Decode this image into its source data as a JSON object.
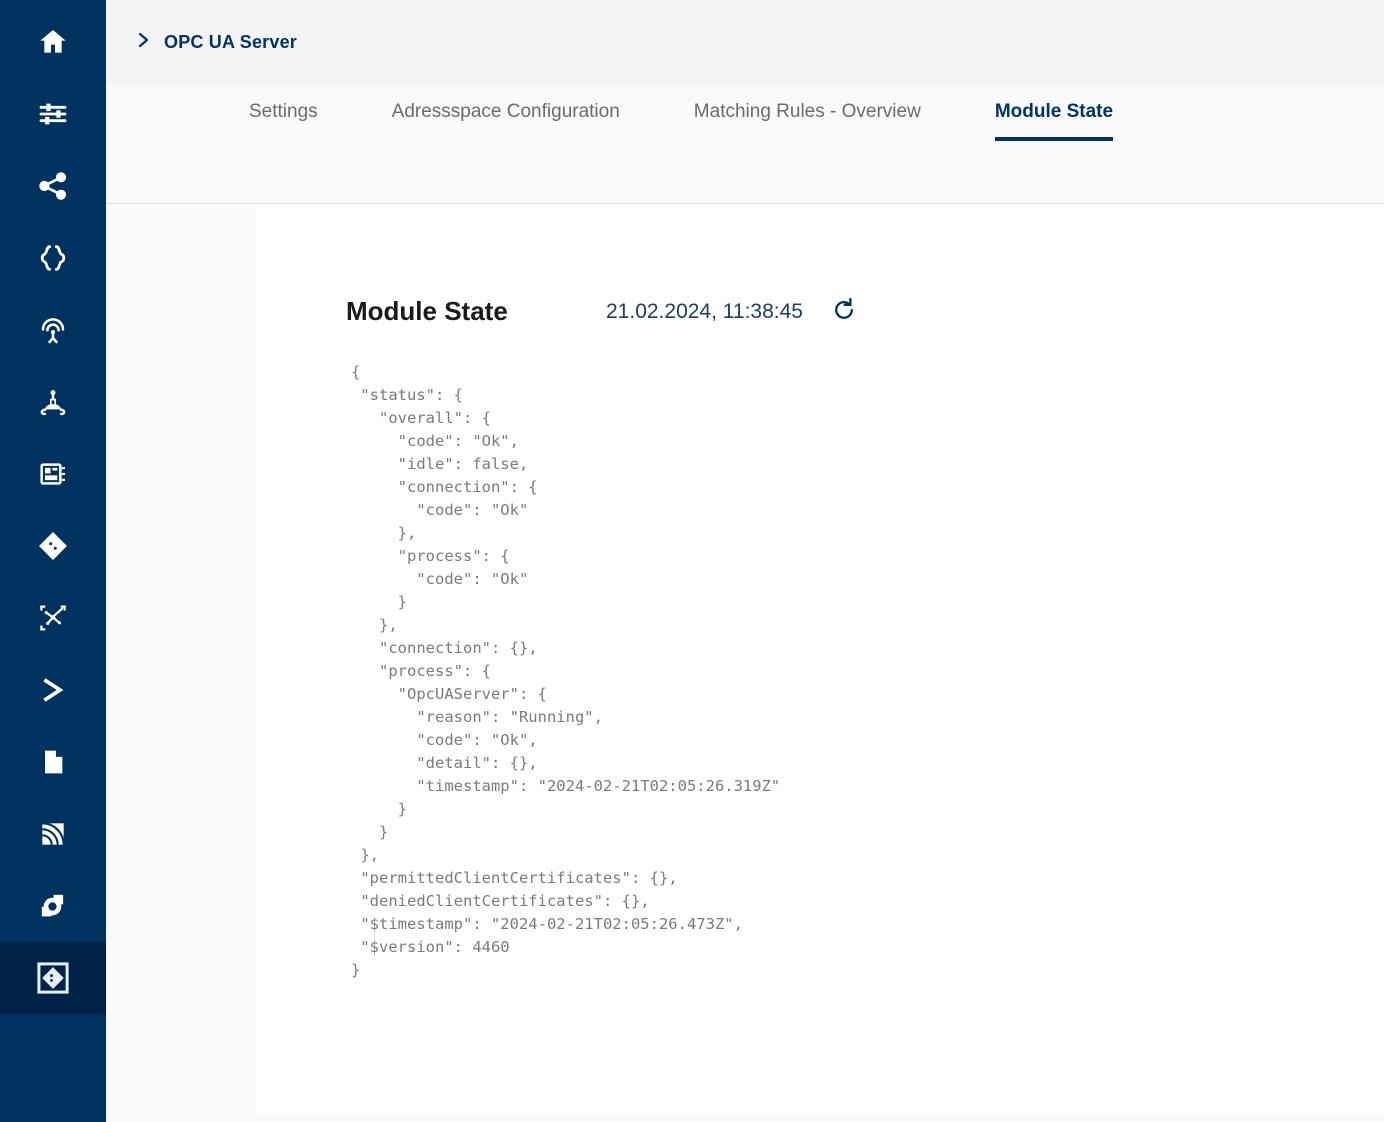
{
  "sidebar": {
    "items": [
      {
        "name": "home-icon",
        "label": "Home",
        "active": false
      },
      {
        "name": "sliders-icon",
        "label": "Settings",
        "active": false
      },
      {
        "name": "share-icon",
        "label": "Share",
        "active": false
      },
      {
        "name": "curly-braces-icon",
        "label": "JSON",
        "active": false
      },
      {
        "name": "broadcast-icon",
        "label": "Broadcast",
        "active": false
      },
      {
        "name": "robot-icon",
        "label": "Robot",
        "active": false
      },
      {
        "name": "device-icon",
        "label": "Device",
        "active": false
      },
      {
        "name": "diamond-icon",
        "label": "Diamond",
        "active": false
      },
      {
        "name": "topology-icon",
        "label": "Topology",
        "active": false
      },
      {
        "name": "chevron-right-icon",
        "label": "Console",
        "active": false
      },
      {
        "name": "file-icon",
        "label": "File",
        "active": false
      },
      {
        "name": "signal-icon",
        "label": "Signal",
        "active": false
      },
      {
        "name": "gear-ring-icon",
        "label": "Service",
        "active": false
      },
      {
        "name": "boxed-diamond-icon",
        "label": "OPC UA Server",
        "active": true
      }
    ]
  },
  "header": {
    "breadcrumb_icon": "chevron-right-icon",
    "title": "OPC UA Server"
  },
  "tabs": [
    {
      "label": "Settings",
      "active": false
    },
    {
      "label": "Adressspace Configuration",
      "active": false
    },
    {
      "label": "Matching Rules - Overview",
      "active": false
    },
    {
      "label": "Module State",
      "active": true
    }
  ],
  "module_state": {
    "title": "Module State",
    "timestamp": "21.02.2024, 11:38:45",
    "refresh_icon": "refresh-icon",
    "json": "{\n \"status\": {\n   \"overall\": {\n     \"code\": \"Ok\",\n     \"idle\": false,\n     \"connection\": {\n       \"code\": \"Ok\"\n     },\n     \"process\": {\n       \"code\": \"Ok\"\n     }\n   },\n   \"connection\": {},\n   \"process\": {\n     \"OpcUAServer\": {\n       \"reason\": \"Running\",\n       \"code\": \"Ok\",\n       \"detail\": {},\n       \"timestamp\": \"2024-02-21T02:05:26.319Z\"\n     }\n   }\n },\n \"permittedClientCertificates\": {},\n \"deniedClientCertificates\": {},\n \"$timestamp\": \"2024-02-21T02:05:26.473Z\",\n \"$version\": 4460\n}"
  },
  "colors": {
    "sidebar_bg": "#00325f",
    "sidebar_active_bg": "#002247",
    "accent": "#003366",
    "header_band_bg": "#f4f4f4",
    "page_bg": "#fafafa",
    "card_bg": "#ffffff",
    "json_text": "#7b7b7b",
    "tab_inactive": "#6b6b6b"
  }
}
